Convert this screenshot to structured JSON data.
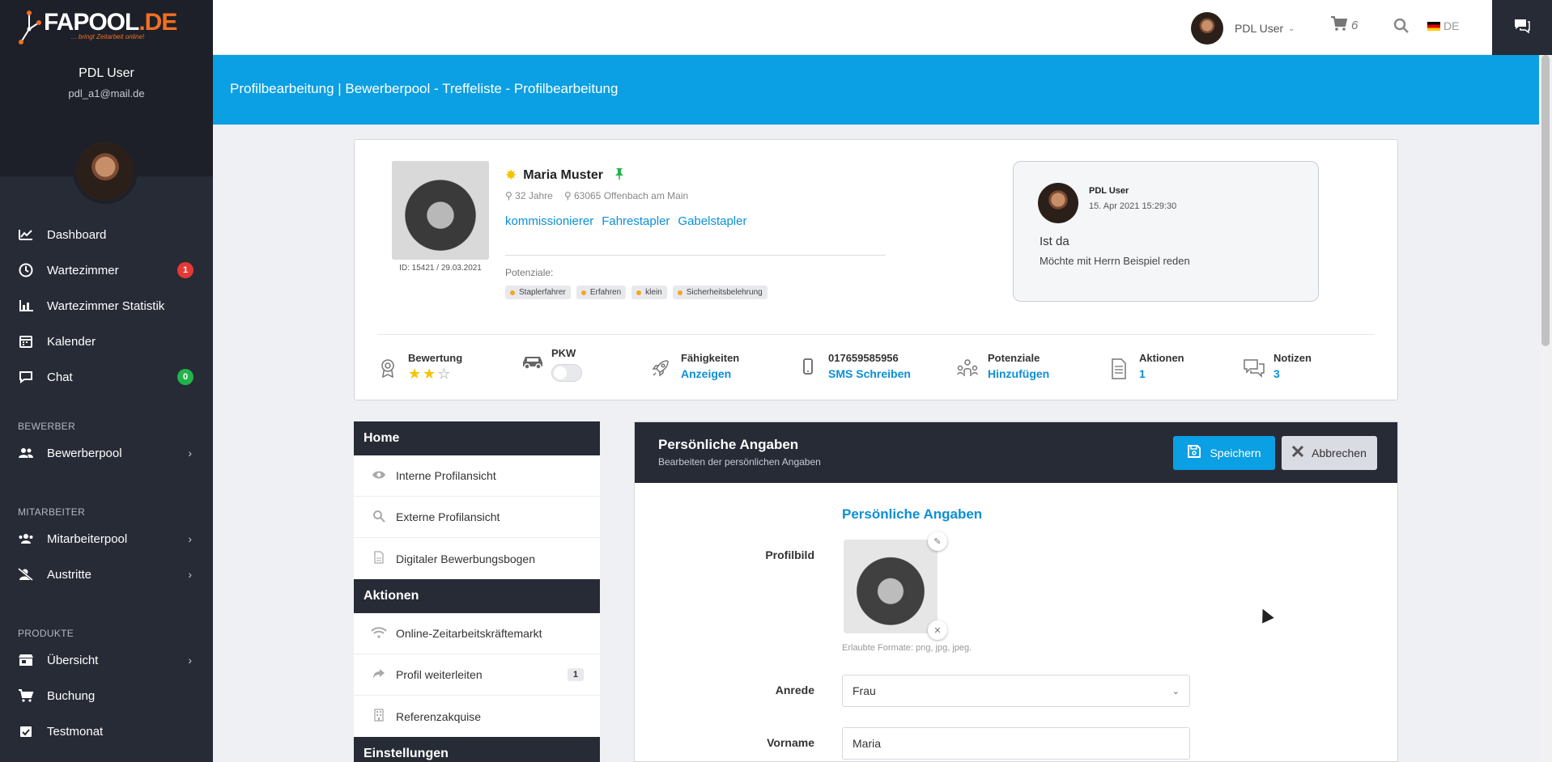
{
  "sidebar": {
    "logo": {
      "brand": "FAPOOL",
      "tld": ".DE",
      "tagline": "... bringt Zeitarbeit online!"
    },
    "user": {
      "name": "PDL User",
      "email": "pdl_a1@mail.de"
    },
    "items": [
      {
        "label": "Dashboard",
        "icon": "chart-line-icon"
      },
      {
        "label": "Wartezimmer",
        "icon": "clock-icon",
        "badge": "1"
      },
      {
        "label": "Wartezimmer Statistik",
        "icon": "bar-chart-icon"
      },
      {
        "label": "Kalender",
        "icon": "calendar-icon"
      },
      {
        "label": "Chat",
        "icon": "chat-icon",
        "badge": "0"
      }
    ],
    "section_bewerber": "BEWERBER",
    "bewerber_items": [
      {
        "label": "Bewerberpool",
        "icon": "users-icon"
      }
    ],
    "section_mitarbeiter": "MITARBEITER",
    "mitarbeiter_items": [
      {
        "label": "Mitarbeiterpool",
        "icon": "users-group-icon"
      },
      {
        "label": "Austritte",
        "icon": "user-remove-icon"
      }
    ],
    "section_produkte": "PRODUKTE",
    "produkte_items": [
      {
        "label": "Übersicht",
        "icon": "store-icon"
      },
      {
        "label": "Buchung",
        "icon": "cart-icon"
      },
      {
        "label": "Testmonat",
        "icon": "calendar-check-icon"
      }
    ]
  },
  "topbar": {
    "user_name": "PDL User",
    "cart_count": "6",
    "language": "DE"
  },
  "banner": {
    "title": "Profilbearbeitung | Bewerberpool - Treffeliste - Profilbearbeitung"
  },
  "profile": {
    "name": "Maria Muster",
    "age": "32 Jahre",
    "location": "63065 Offenbach am Main",
    "skills": [
      "kommissionierer",
      "Fahrestapler",
      "Gabelstapler"
    ],
    "id_text": "ID: 15421 / 29.03.2021",
    "potenziale_label": "Potenziale:",
    "tags": [
      "Staplerfahrer",
      "Erfahren",
      "klein",
      "Sicherheitsbelehrung"
    ]
  },
  "note": {
    "user": "PDL User",
    "date": "15. Apr 2021 15:29:30",
    "title": "Ist da",
    "text": "Möchte mit Herrn Beispiel reden"
  },
  "stats": {
    "bewertung": {
      "label": "Bewertung",
      "rating": 2,
      "max": 3
    },
    "pkw": {
      "label": "PKW"
    },
    "faehigkeiten": {
      "label": "Fähigkeiten",
      "value": "Anzeigen"
    },
    "phone": {
      "label": "017659585956",
      "value": "SMS Schreiben"
    },
    "potenziale": {
      "label": "Potenziale",
      "value": "Hinzufügen"
    },
    "aktionen": {
      "label": "Aktionen",
      "value": "1"
    },
    "notizen": {
      "label": "Notizen",
      "value": "3"
    }
  },
  "menu": {
    "home_title": "Home",
    "home_items": [
      {
        "label": "Interne Profilansicht",
        "icon": "eye-icon"
      },
      {
        "label": "Externe Profilansicht",
        "icon": "search-icon"
      },
      {
        "label": "Digitaler Bewerbungsbogen",
        "icon": "document-icon"
      }
    ],
    "aktionen_title": "Aktionen",
    "aktionen_items": [
      {
        "label": "Online-Zeitarbeitskräftemarkt",
        "icon": "wifi-icon"
      },
      {
        "label": "Profil weiterleiten",
        "icon": "share-icon",
        "count": "1"
      },
      {
        "label": "Referenzakquise",
        "icon": "building-icon"
      }
    ],
    "einstellungen_title": "Einstellungen"
  },
  "form": {
    "title": "Persönliche Angaben",
    "subtitle": "Bearbeiten der persönlichen Angaben",
    "save_label": "Speichern",
    "cancel_label": "Abbrechen",
    "section_title": "Persönliche Angaben",
    "profilbild_label": "Profilbild",
    "formats_hint": "Erlaubte Formate: png, jpg, jpeg.",
    "anrede_label": "Anrede",
    "anrede_value": "Frau",
    "vorname_label": "Vorname",
    "vorname_value": "Maria"
  },
  "colors": {
    "accent": "#0b9fe3",
    "sidebar": "#272b36",
    "badge_red": "#e53935",
    "badge_green": "#22b34a",
    "star": "#f5c400"
  }
}
